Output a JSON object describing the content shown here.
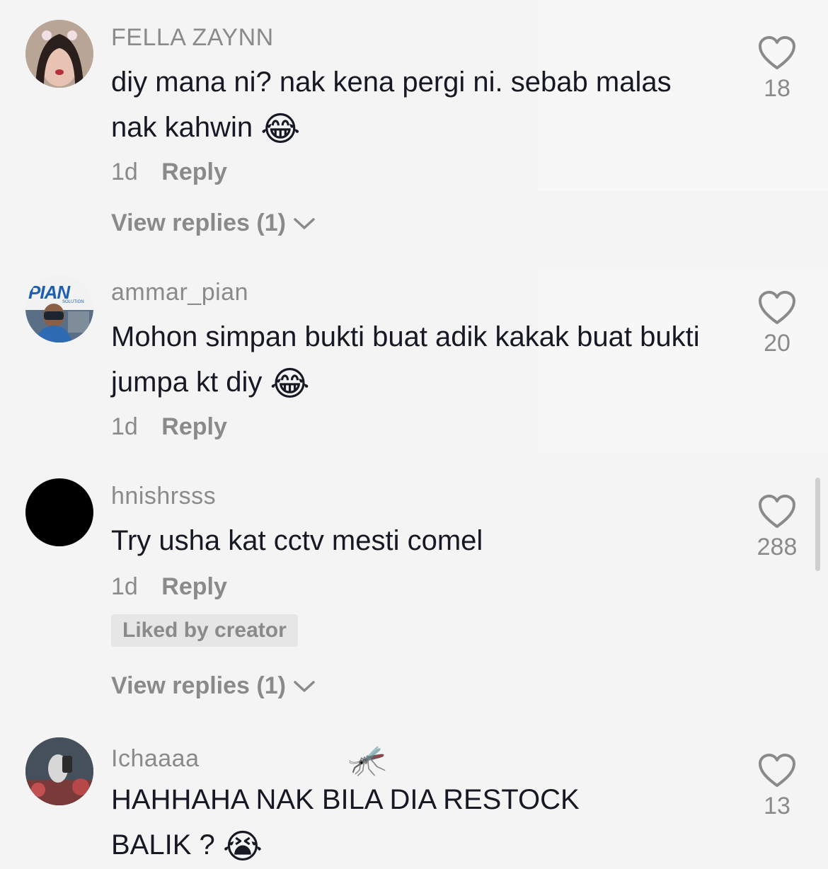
{
  "comments": [
    {
      "username": "FELLA ZAYNN",
      "text": "diy mana ni? nak kena pergi ni. sebab malas nak kahwin",
      "emoji": "😂",
      "time": "1d",
      "reply_label": "Reply",
      "view_replies": "View replies (1)",
      "likes": "18"
    },
    {
      "username": "ammar_pian",
      "text": "Mohon simpan bukti buat adik kakak buat bukti jumpa kt diy",
      "emoji": "😂",
      "time": "1d",
      "reply_label": "Reply",
      "likes": "20",
      "avatar_logo": "PIAN",
      "avatar_sub": "SOLUTION"
    },
    {
      "username": "hnishrsss",
      "text": "Try usha kat cctv mesti comel",
      "time": "1d",
      "reply_label": "Reply",
      "liked_by_creator": "Liked by creator",
      "view_replies": "View replies (1)",
      "likes": "288"
    },
    {
      "username": "Ichaaaa",
      "username_emoji": "🦟",
      "text": "HAHHAHA NAK BILA DIA RESTOCK BALIK ?",
      "emoji": "😭",
      "likes": "13"
    }
  ],
  "colors": {
    "background": "#f4f4f4",
    "text": "#161823",
    "secondary": "#8a8a8a"
  },
  "icons": {
    "like": "heart-outline-icon",
    "expand": "chevron-down-icon"
  }
}
